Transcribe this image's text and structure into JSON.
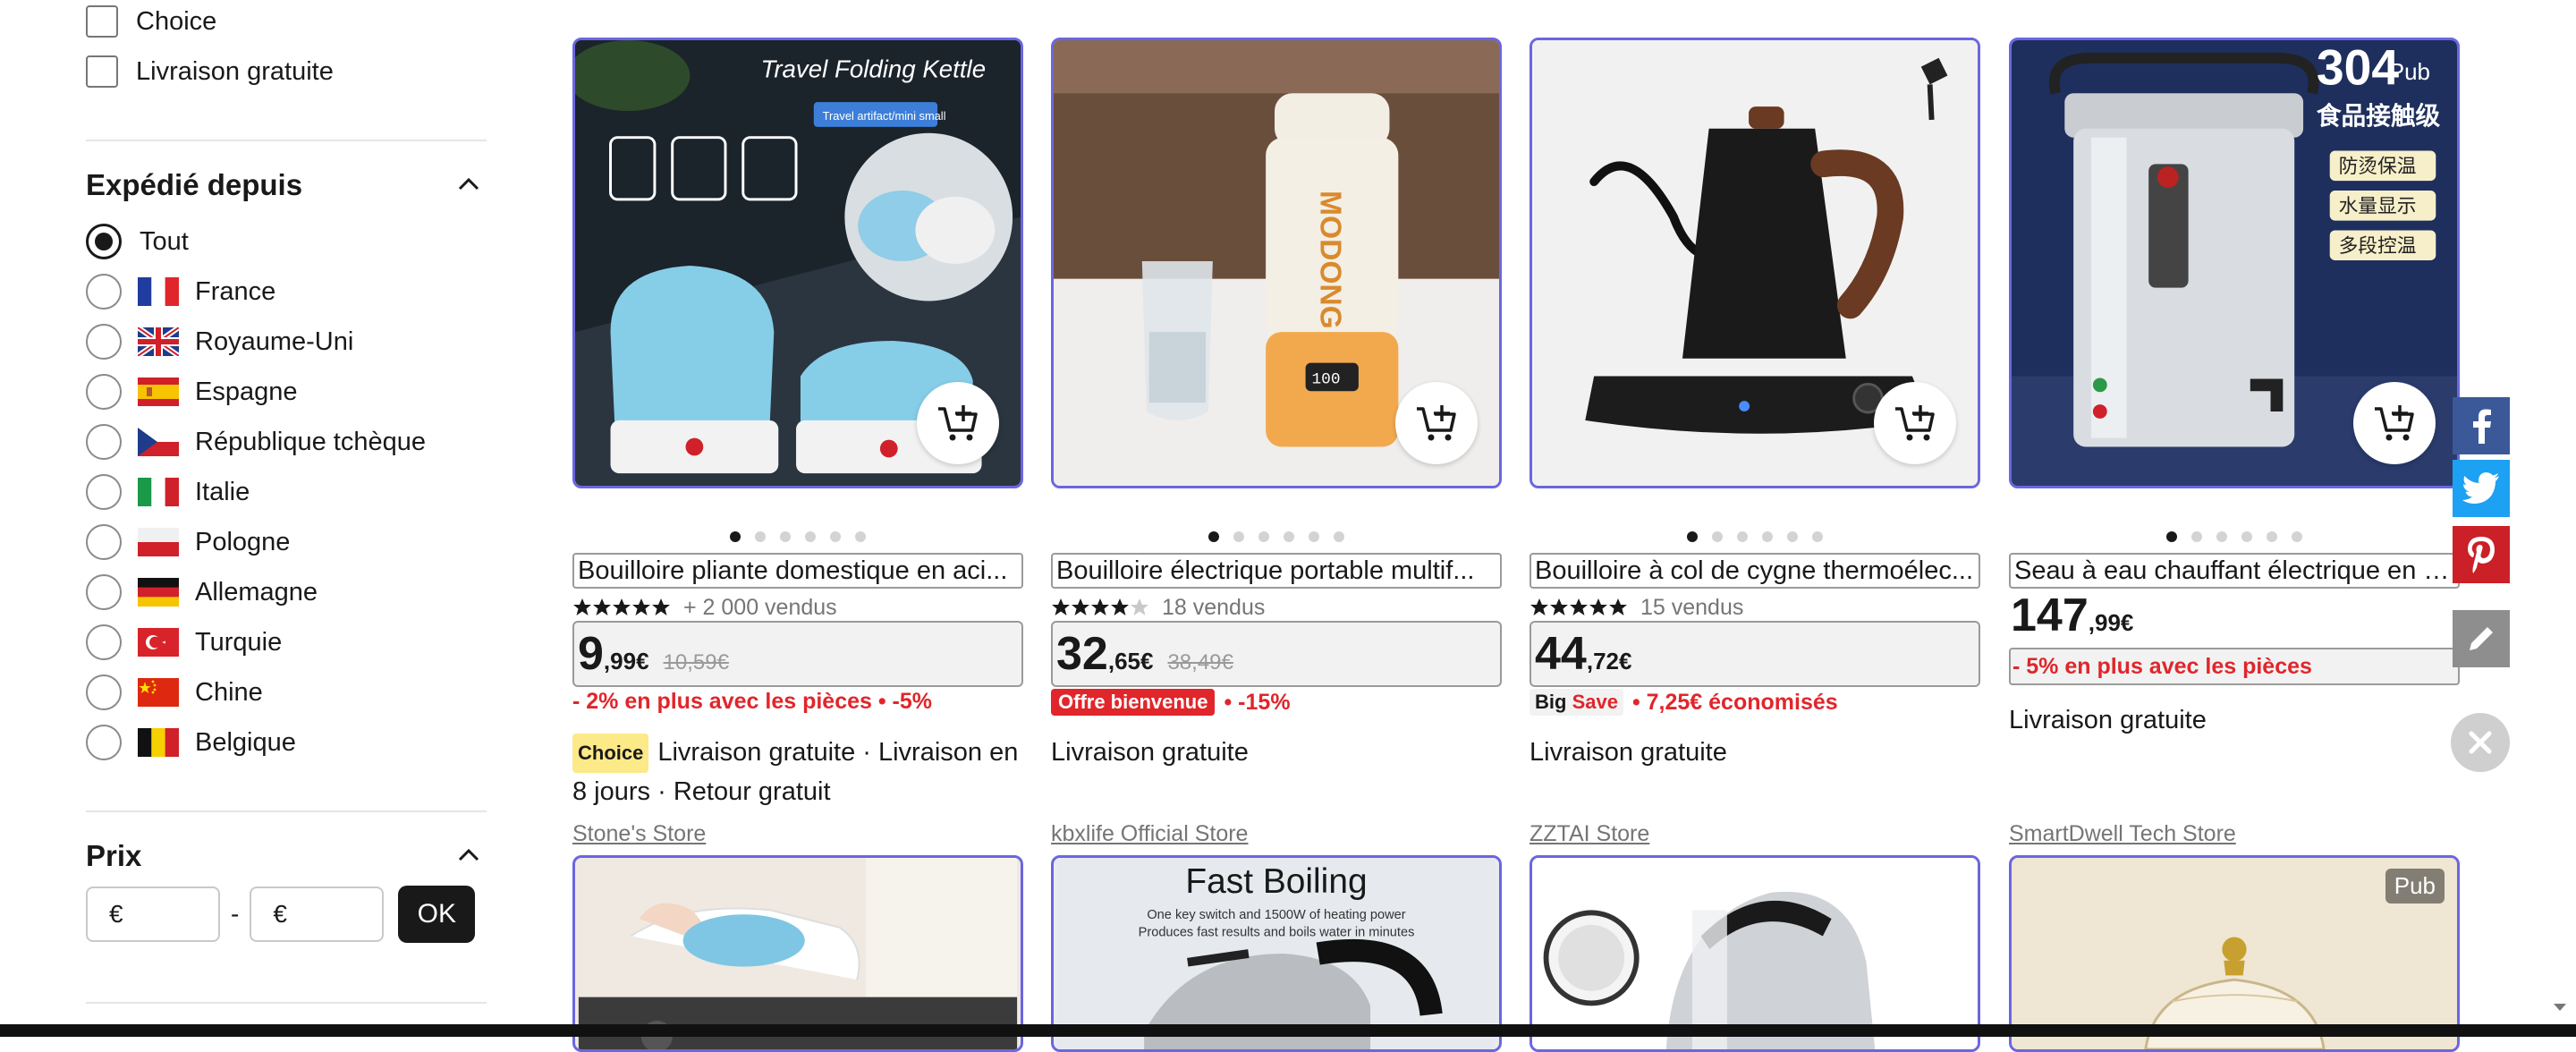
{
  "filters": {
    "checkboxes": [
      {
        "label": "Choice",
        "checked": false
      },
      {
        "label": "Livraison gratuite",
        "checked": false
      }
    ],
    "ships_from": {
      "title": "Expédié depuis",
      "options": [
        {
          "label": "Tout",
          "selected": true,
          "flag": ""
        },
        {
          "label": "France",
          "selected": false,
          "flag": "fr"
        },
        {
          "label": "Royaume-Uni",
          "selected": false,
          "flag": "gb"
        },
        {
          "label": "Espagne",
          "selected": false,
          "flag": "es"
        },
        {
          "label": "République tchèque",
          "selected": false,
          "flag": "cz"
        },
        {
          "label": "Italie",
          "selected": false,
          "flag": "it"
        },
        {
          "label": "Pologne",
          "selected": false,
          "flag": "pl"
        },
        {
          "label": "Allemagne",
          "selected": false,
          "flag": "de"
        },
        {
          "label": "Turquie",
          "selected": false,
          "flag": "tr"
        },
        {
          "label": "Chine",
          "selected": false,
          "flag": "cn"
        },
        {
          "label": "Belgique",
          "selected": false,
          "flag": "be"
        }
      ]
    },
    "price": {
      "title": "Prix",
      "min_placeholder": "€",
      "max_placeholder": "€",
      "separator": "-",
      "ok_label": "OK"
    }
  },
  "products": [
    {
      "image_text": "Travel Folding Kettle",
      "image_subtext": "Travel artifact/mini small",
      "title": "Bouilloire pliante domestique en aci...",
      "rating_stars": 5,
      "sold": "+ 2 000 vendus",
      "price_int": "9",
      "price_dec": ",99€",
      "price_old": "10,59€",
      "promo_badge": "",
      "promo_text": "- 2% en plus avec les pièces • -5%",
      "choice_badge": "Choice",
      "shipping": "Livraison gratuite · Livraison en 8 jours · Retour gratuit",
      "store": "Stone's Store",
      "ad": false
    },
    {
      "image_text": "MODONG",
      "image_subtext": "100",
      "title": "Bouilloire électrique portable multif...",
      "rating_stars": 4.5,
      "sold": "18 vendus",
      "price_int": "32",
      "price_dec": ",65€",
      "price_old": "38,49€",
      "promo_badge": "Offre bienvenue",
      "promo_text": "• -15%",
      "choice_badge": "",
      "shipping": "Livraison gratuite",
      "store": "kbxlife Official Store",
      "ad": false
    },
    {
      "image_text": "",
      "image_subtext": "",
      "title": "Bouilloire à col de cygne thermoélec...",
      "rating_stars": 5,
      "sold": "15 vendus",
      "price_int": "44",
      "price_dec": ",72€",
      "price_old": "",
      "promo_badge": "Big Save",
      "promo_text": "• 7,25€ économisés",
      "choice_badge": "",
      "shipping": "Livraison gratuite",
      "store": "ZZTAI Store",
      "ad": false
    },
    {
      "image_text": "304",
      "image_subtext": "食品接触级",
      "image_tags": [
        "防烫保温",
        "水量显示",
        "多段控温"
      ],
      "title": "Seau à eau chauffant électrique en a...",
      "rating_stars": 0,
      "sold": "",
      "price_int": "147",
      "price_dec": ",99€",
      "price_old": "",
      "promo_badge": "",
      "promo_text": "- 5% en plus avec les pièces",
      "choice_badge": "",
      "shipping": "Livraison gratuite",
      "store": "SmartDwell Tech Store",
      "ad": true,
      "ad_label": "Pub"
    }
  ],
  "second_row": {
    "card2_title": "Fast Boiling",
    "card2_sub1": "One key switch and 1500W of heating power",
    "card2_sub2": "Produces fast results and boils water in minutes",
    "card4_ad_label": "Pub"
  },
  "share_icons": [
    "facebook-icon",
    "twitter-icon",
    "pinterest-icon",
    "edit-icon",
    "close-icon"
  ],
  "colors": {
    "card_border": "#6b66e0",
    "promo_red": "#e0262b",
    "facebook": "#3b5998",
    "twitter": "#1da1f2",
    "pinterest": "#cb2027"
  }
}
